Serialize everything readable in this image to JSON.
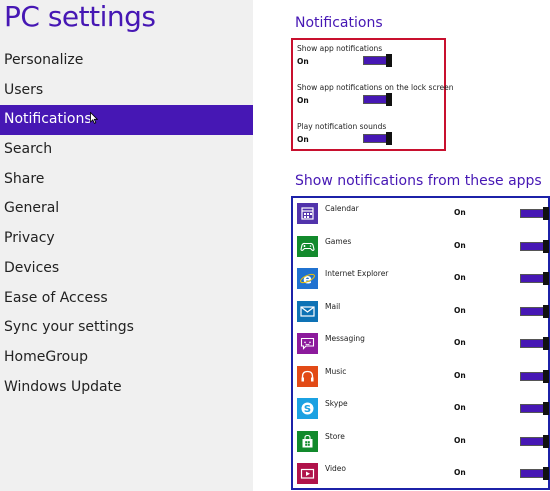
{
  "app_title": "PC settings",
  "nav": [
    {
      "label": "Personalize"
    },
    {
      "label": "Users"
    },
    {
      "label": "Notifications",
      "selected": true
    },
    {
      "label": "Search"
    },
    {
      "label": "Share"
    },
    {
      "label": "General"
    },
    {
      "label": "Privacy"
    },
    {
      "label": "Devices"
    },
    {
      "label": "Ease of Access"
    },
    {
      "label": "Sync your settings"
    },
    {
      "label": "HomeGroup"
    },
    {
      "label": "Windows Update"
    }
  ],
  "notifications": {
    "heading": "Notifications",
    "settings": [
      {
        "label": "Show app notifications",
        "value": "On",
        "on": true
      },
      {
        "label": "Show app notifications on the lock screen",
        "value": "On",
        "on": true
      },
      {
        "label": "Play notification sounds",
        "value": "On",
        "on": true
      }
    ]
  },
  "apps": {
    "heading": "Show notifications from these apps",
    "items": [
      {
        "name": "Calendar",
        "status": "On",
        "icon": "calendar-icon",
        "color": "#5133ab"
      },
      {
        "name": "Games",
        "status": "On",
        "icon": "games-icon",
        "color": "#128a2c"
      },
      {
        "name": "Internet Explorer",
        "status": "On",
        "icon": "internet-explorer-icon",
        "color": "#2072d0"
      },
      {
        "name": "Mail",
        "status": "On",
        "icon": "mail-icon",
        "color": "#0e72b5"
      },
      {
        "name": "Messaging",
        "status": "On",
        "icon": "messaging-icon",
        "color": "#8c1a9c"
      },
      {
        "name": "Music",
        "status": "On",
        "icon": "music-icon",
        "color": "#e24a16"
      },
      {
        "name": "Skype",
        "status": "On",
        "icon": "skype-icon",
        "color": "#1ba1e2"
      },
      {
        "name": "Store",
        "status": "On",
        "icon": "store-icon",
        "color": "#128a2c"
      },
      {
        "name": "Video",
        "status": "On",
        "icon": "video-icon",
        "color": "#b0124a"
      }
    ]
  },
  "colors": {
    "accent": "#4617b4",
    "notifications_box_border": "#c8102e",
    "apps_box_border": "#1c21a8"
  }
}
